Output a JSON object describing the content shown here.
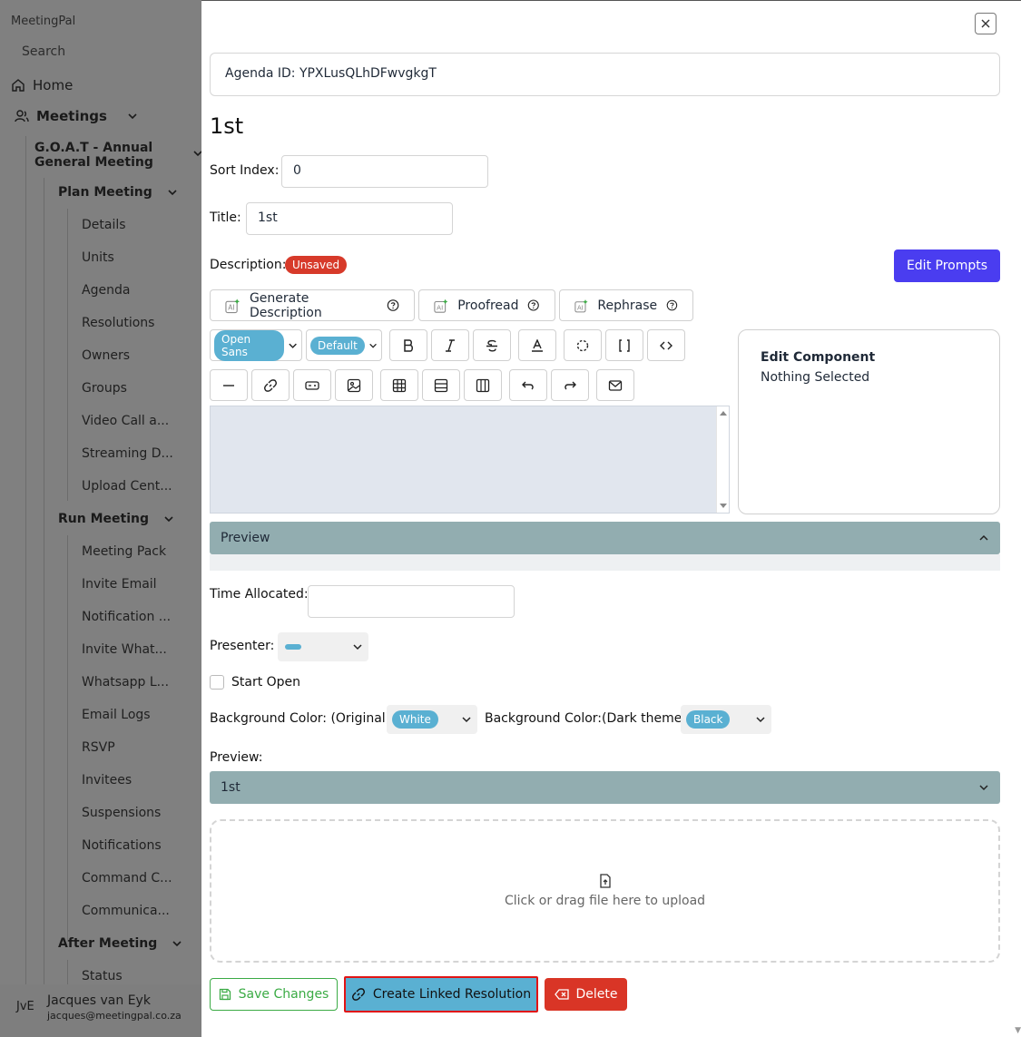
{
  "sidebar": {
    "app_name": "MeetingPal",
    "search_placeholder": "Search",
    "home": "Home",
    "meetings": "Meetings",
    "meeting_name": "G.O.A.T - Annual General Meeting",
    "plan_meeting": {
      "label": "Plan Meeting",
      "items": [
        "Details",
        "Units",
        "Agenda",
        "Resolutions",
        "Owners",
        "Groups",
        "Video Call a...",
        "Streaming D...",
        "Upload Cent..."
      ]
    },
    "run_meeting": {
      "label": "Run Meeting",
      "items": [
        "Meeting Pack",
        "Invite Email",
        "Notification ...",
        "Invite What...",
        "Whatsapp L...",
        "Email Logs",
        "RSVP",
        "Invitees",
        "Suspensions",
        "Notifications",
        "Command C...",
        "Communica..."
      ]
    },
    "after_meeting": {
      "label": "After Meeting",
      "items": [
        "Status"
      ]
    },
    "user": {
      "initials": "JvE",
      "name": "Jacques van Eyk",
      "email": "jacques@meetingpal.co.za"
    }
  },
  "panel": {
    "agenda_id": "Agenda ID: YPXLusQLhDFwvgkgT",
    "heading": "1st",
    "sort_index_label": "Sort Index:",
    "sort_index_value": "0",
    "title_label": "Title:",
    "title_value": "1st",
    "description_label": "Description:",
    "unsaved_badge": "Unsaved",
    "edit_prompts": "Edit Prompts",
    "ai_buttons": [
      "Generate Description",
      "Proofread",
      "Rephrase"
    ],
    "font_family": "Open Sans",
    "font_size": "Default",
    "edit_component_title": "Edit Component",
    "edit_component_status": "Nothing Selected",
    "preview_label": "Preview",
    "time_allocated_label": "Time Allocated:",
    "time_allocated_value": "",
    "presenter_label": "Presenter:",
    "start_open_label": "Start Open",
    "bg_original_label": "Background Color: (Original)",
    "bg_original_value": "White",
    "bg_dark_label": "Background Color:(Dark theme)",
    "bg_dark_value": "Black",
    "preview2_label": "Preview:",
    "preview2_title": "1st",
    "upload_text": "Click or drag file here to upload",
    "save_changes": "Save Changes",
    "create_linked_resolution": "Create Linked Resolution",
    "delete": "Delete"
  },
  "colors": {
    "accent_purple": "#4a3df0",
    "unsaved_red": "#d73a2a",
    "pill_blue": "#5ab0d2",
    "accordion": "#92adb0",
    "save_green": "#3bab45",
    "delete_red": "#d93526",
    "highlight_border": "#e11414"
  }
}
